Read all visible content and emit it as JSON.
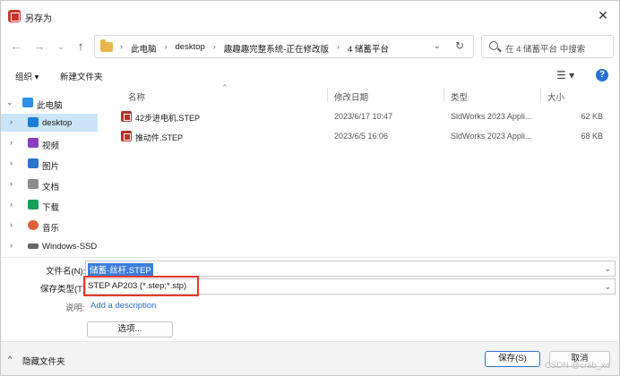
{
  "window": {
    "title": "另存为"
  },
  "address": {
    "crumbs": [
      "此电脑",
      "desktop",
      "趣趣趣完整系统-正在修改版",
      "4 储蓄平台"
    ],
    "search_placeholder": "在 4 储蓄平台 中搜索"
  },
  "toolbar": {
    "organize": "组织 ▾",
    "new_folder": "新建文件夹"
  },
  "nav": {
    "items": [
      {
        "label": "此电脑",
        "icon": "computer-icon",
        "color": "#2f8ee8"
      },
      {
        "label": "desktop",
        "icon": "desktop-icon",
        "color": "#1e7bd8"
      },
      {
        "label": "视频",
        "icon": "video-icon",
        "color": "#8b3fbf"
      },
      {
        "label": "图片",
        "icon": "picture-icon",
        "color": "#2a74c9"
      },
      {
        "label": "文档",
        "icon": "document-icon",
        "color": "#8c8c8c"
      },
      {
        "label": "下载",
        "icon": "download-icon",
        "color": "#1aa05a"
      },
      {
        "label": "音乐",
        "icon": "music-icon",
        "color": "#e0623b"
      },
      {
        "label": "Windows-SSD",
        "icon": "drive-icon",
        "color": "#666666"
      }
    ]
  },
  "columns": {
    "name": "名称",
    "date": "修改日期",
    "type": "类型",
    "size": "大小"
  },
  "files": [
    {
      "name": "42步进电机.STEP",
      "date": "2023/6/17 10:47",
      "type": "SldWorks 2023 Appli...",
      "size": "62 KB"
    },
    {
      "name": "推动件.STEP",
      "date": "2023/6/5 16:06",
      "type": "SldWorks 2023 Appli...",
      "size": "68 KB"
    }
  ],
  "form": {
    "filename_label": "文件名(N):",
    "filename_value": "储蓄-丝杆.STEP",
    "savetype_label": "保存类型(T):",
    "savetype_value": "STEP AP203 (*.step;*.stp)",
    "desc_label": "说明:",
    "desc_link": "Add a description",
    "options_button": "选项..."
  },
  "footer": {
    "hide_folders": "隐藏文件夹",
    "save_button": "保存(S)",
    "cancel_button": "取消"
  },
  "watermark": "CSDN @crab_xd",
  "colors": {
    "accent": "#2f6fd1",
    "selection": "#cce4f7",
    "highlight_box": "#e53a2a"
  }
}
